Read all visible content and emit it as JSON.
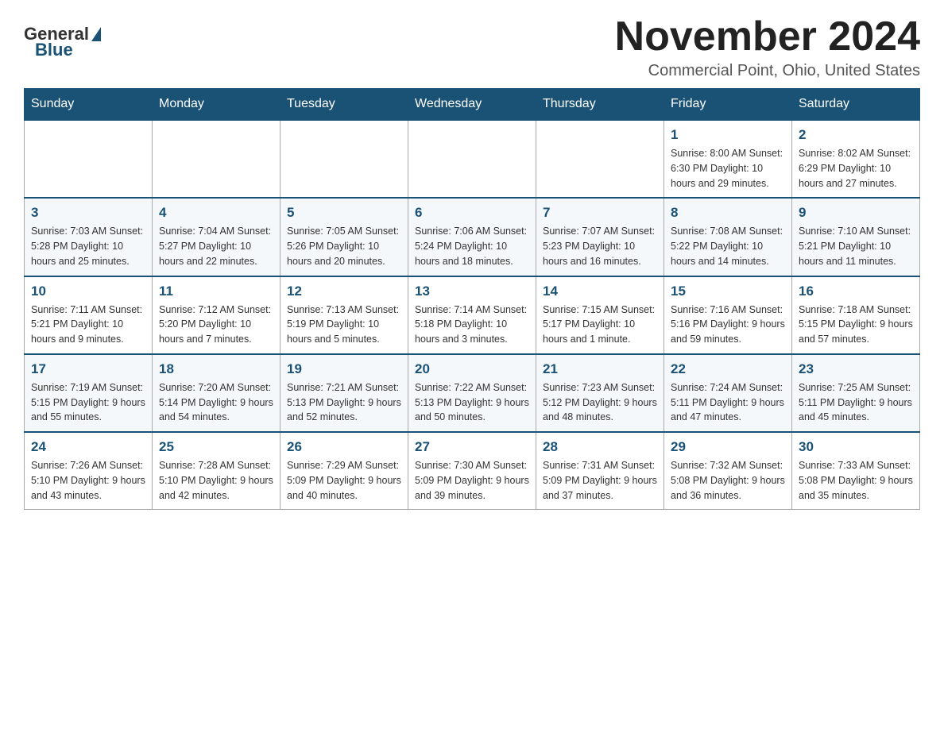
{
  "header": {
    "logo": {
      "general": "General",
      "blue": "Blue"
    },
    "title": "November 2024",
    "location": "Commercial Point, Ohio, United States"
  },
  "weekdays": [
    "Sunday",
    "Monday",
    "Tuesday",
    "Wednesday",
    "Thursday",
    "Friday",
    "Saturday"
  ],
  "weeks": [
    [
      {
        "day": "",
        "info": ""
      },
      {
        "day": "",
        "info": ""
      },
      {
        "day": "",
        "info": ""
      },
      {
        "day": "",
        "info": ""
      },
      {
        "day": "",
        "info": ""
      },
      {
        "day": "1",
        "info": "Sunrise: 8:00 AM\nSunset: 6:30 PM\nDaylight: 10 hours and 29 minutes."
      },
      {
        "day": "2",
        "info": "Sunrise: 8:02 AM\nSunset: 6:29 PM\nDaylight: 10 hours and 27 minutes."
      }
    ],
    [
      {
        "day": "3",
        "info": "Sunrise: 7:03 AM\nSunset: 5:28 PM\nDaylight: 10 hours and 25 minutes."
      },
      {
        "day": "4",
        "info": "Sunrise: 7:04 AM\nSunset: 5:27 PM\nDaylight: 10 hours and 22 minutes."
      },
      {
        "day": "5",
        "info": "Sunrise: 7:05 AM\nSunset: 5:26 PM\nDaylight: 10 hours and 20 minutes."
      },
      {
        "day": "6",
        "info": "Sunrise: 7:06 AM\nSunset: 5:24 PM\nDaylight: 10 hours and 18 minutes."
      },
      {
        "day": "7",
        "info": "Sunrise: 7:07 AM\nSunset: 5:23 PM\nDaylight: 10 hours and 16 minutes."
      },
      {
        "day": "8",
        "info": "Sunrise: 7:08 AM\nSunset: 5:22 PM\nDaylight: 10 hours and 14 minutes."
      },
      {
        "day": "9",
        "info": "Sunrise: 7:10 AM\nSunset: 5:21 PM\nDaylight: 10 hours and 11 minutes."
      }
    ],
    [
      {
        "day": "10",
        "info": "Sunrise: 7:11 AM\nSunset: 5:21 PM\nDaylight: 10 hours and 9 minutes."
      },
      {
        "day": "11",
        "info": "Sunrise: 7:12 AM\nSunset: 5:20 PM\nDaylight: 10 hours and 7 minutes."
      },
      {
        "day": "12",
        "info": "Sunrise: 7:13 AM\nSunset: 5:19 PM\nDaylight: 10 hours and 5 minutes."
      },
      {
        "day": "13",
        "info": "Sunrise: 7:14 AM\nSunset: 5:18 PM\nDaylight: 10 hours and 3 minutes."
      },
      {
        "day": "14",
        "info": "Sunrise: 7:15 AM\nSunset: 5:17 PM\nDaylight: 10 hours and 1 minute."
      },
      {
        "day": "15",
        "info": "Sunrise: 7:16 AM\nSunset: 5:16 PM\nDaylight: 9 hours and 59 minutes."
      },
      {
        "day": "16",
        "info": "Sunrise: 7:18 AM\nSunset: 5:15 PM\nDaylight: 9 hours and 57 minutes."
      }
    ],
    [
      {
        "day": "17",
        "info": "Sunrise: 7:19 AM\nSunset: 5:15 PM\nDaylight: 9 hours and 55 minutes."
      },
      {
        "day": "18",
        "info": "Sunrise: 7:20 AM\nSunset: 5:14 PM\nDaylight: 9 hours and 54 minutes."
      },
      {
        "day": "19",
        "info": "Sunrise: 7:21 AM\nSunset: 5:13 PM\nDaylight: 9 hours and 52 minutes."
      },
      {
        "day": "20",
        "info": "Sunrise: 7:22 AM\nSunset: 5:13 PM\nDaylight: 9 hours and 50 minutes."
      },
      {
        "day": "21",
        "info": "Sunrise: 7:23 AM\nSunset: 5:12 PM\nDaylight: 9 hours and 48 minutes."
      },
      {
        "day": "22",
        "info": "Sunrise: 7:24 AM\nSunset: 5:11 PM\nDaylight: 9 hours and 47 minutes."
      },
      {
        "day": "23",
        "info": "Sunrise: 7:25 AM\nSunset: 5:11 PM\nDaylight: 9 hours and 45 minutes."
      }
    ],
    [
      {
        "day": "24",
        "info": "Sunrise: 7:26 AM\nSunset: 5:10 PM\nDaylight: 9 hours and 43 minutes."
      },
      {
        "day": "25",
        "info": "Sunrise: 7:28 AM\nSunset: 5:10 PM\nDaylight: 9 hours and 42 minutes."
      },
      {
        "day": "26",
        "info": "Sunrise: 7:29 AM\nSunset: 5:09 PM\nDaylight: 9 hours and 40 minutes."
      },
      {
        "day": "27",
        "info": "Sunrise: 7:30 AM\nSunset: 5:09 PM\nDaylight: 9 hours and 39 minutes."
      },
      {
        "day": "28",
        "info": "Sunrise: 7:31 AM\nSunset: 5:09 PM\nDaylight: 9 hours and 37 minutes."
      },
      {
        "day": "29",
        "info": "Sunrise: 7:32 AM\nSunset: 5:08 PM\nDaylight: 9 hours and 36 minutes."
      },
      {
        "day": "30",
        "info": "Sunrise: 7:33 AM\nSunset: 5:08 PM\nDaylight: 9 hours and 35 minutes."
      }
    ]
  ]
}
